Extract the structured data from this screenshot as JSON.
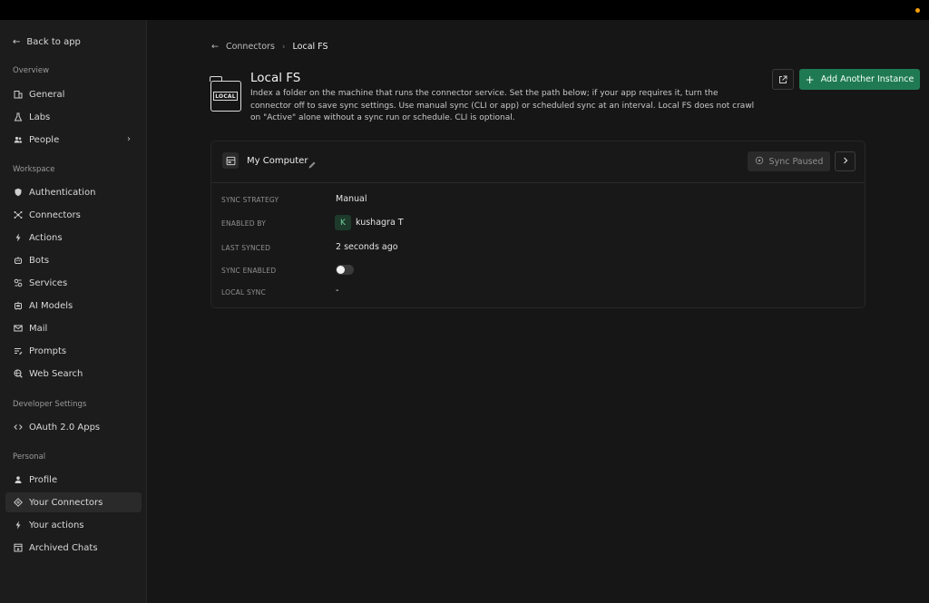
{
  "sidebar": {
    "back_label": "Back to app",
    "sections": {
      "overview": "Overview",
      "workspace": "Workspace",
      "developer": "Developer Settings",
      "personal": "Personal"
    },
    "items": {
      "general": "General",
      "labs": "Labs",
      "people": "People",
      "authentication": "Authentication",
      "connectors": "Connectors",
      "actions": "Actions",
      "bots": "Bots",
      "services": "Services",
      "ai_models": "AI Models",
      "mail": "Mail",
      "prompts": "Prompts",
      "web_search": "Web Search",
      "oauth_apps": "OAuth 2.0 Apps",
      "profile": "Profile",
      "your_connectors": "Your Connectors",
      "your_actions": "Your actions",
      "archived_chats": "Archived Chats"
    },
    "active_item": "your_connectors"
  },
  "breadcrumb": {
    "parent": "Connectors",
    "current": "Local FS"
  },
  "header": {
    "icon_label": "LOCAL",
    "title": "Local FS",
    "description": "Index a folder on the machine that runs the connector service. Set the path below; if your app requires it, turn the connector off to save sync settings. Use manual sync (CLI or app) or scheduled sync at an interval. Local FS does not crawl on \"Active\" alone without a sync run or schedule. CLI is optional.",
    "add_button_label": "Add Another Instance"
  },
  "instance": {
    "name": "My Computer",
    "sync_button_label": "Sync Paused",
    "rows": {
      "sync_strategy_label": "SYNC STRATEGY",
      "sync_strategy_value": "Manual",
      "enabled_by_label": "ENABLED BY",
      "enabled_by_initial": "K",
      "enabled_by_value": "kushagra T",
      "last_synced_label": "LAST SYNCED",
      "last_synced_value": "2 seconds ago",
      "sync_enabled_label": "SYNC ENABLED",
      "sync_enabled": false,
      "local_sync_label": "LOCAL SYNC",
      "local_sync_value": "-"
    }
  },
  "colors": {
    "accent": "#1f7a53",
    "background": "#161616",
    "sidebar": "#1c1c1c",
    "status_dot": "#f59e0b"
  }
}
